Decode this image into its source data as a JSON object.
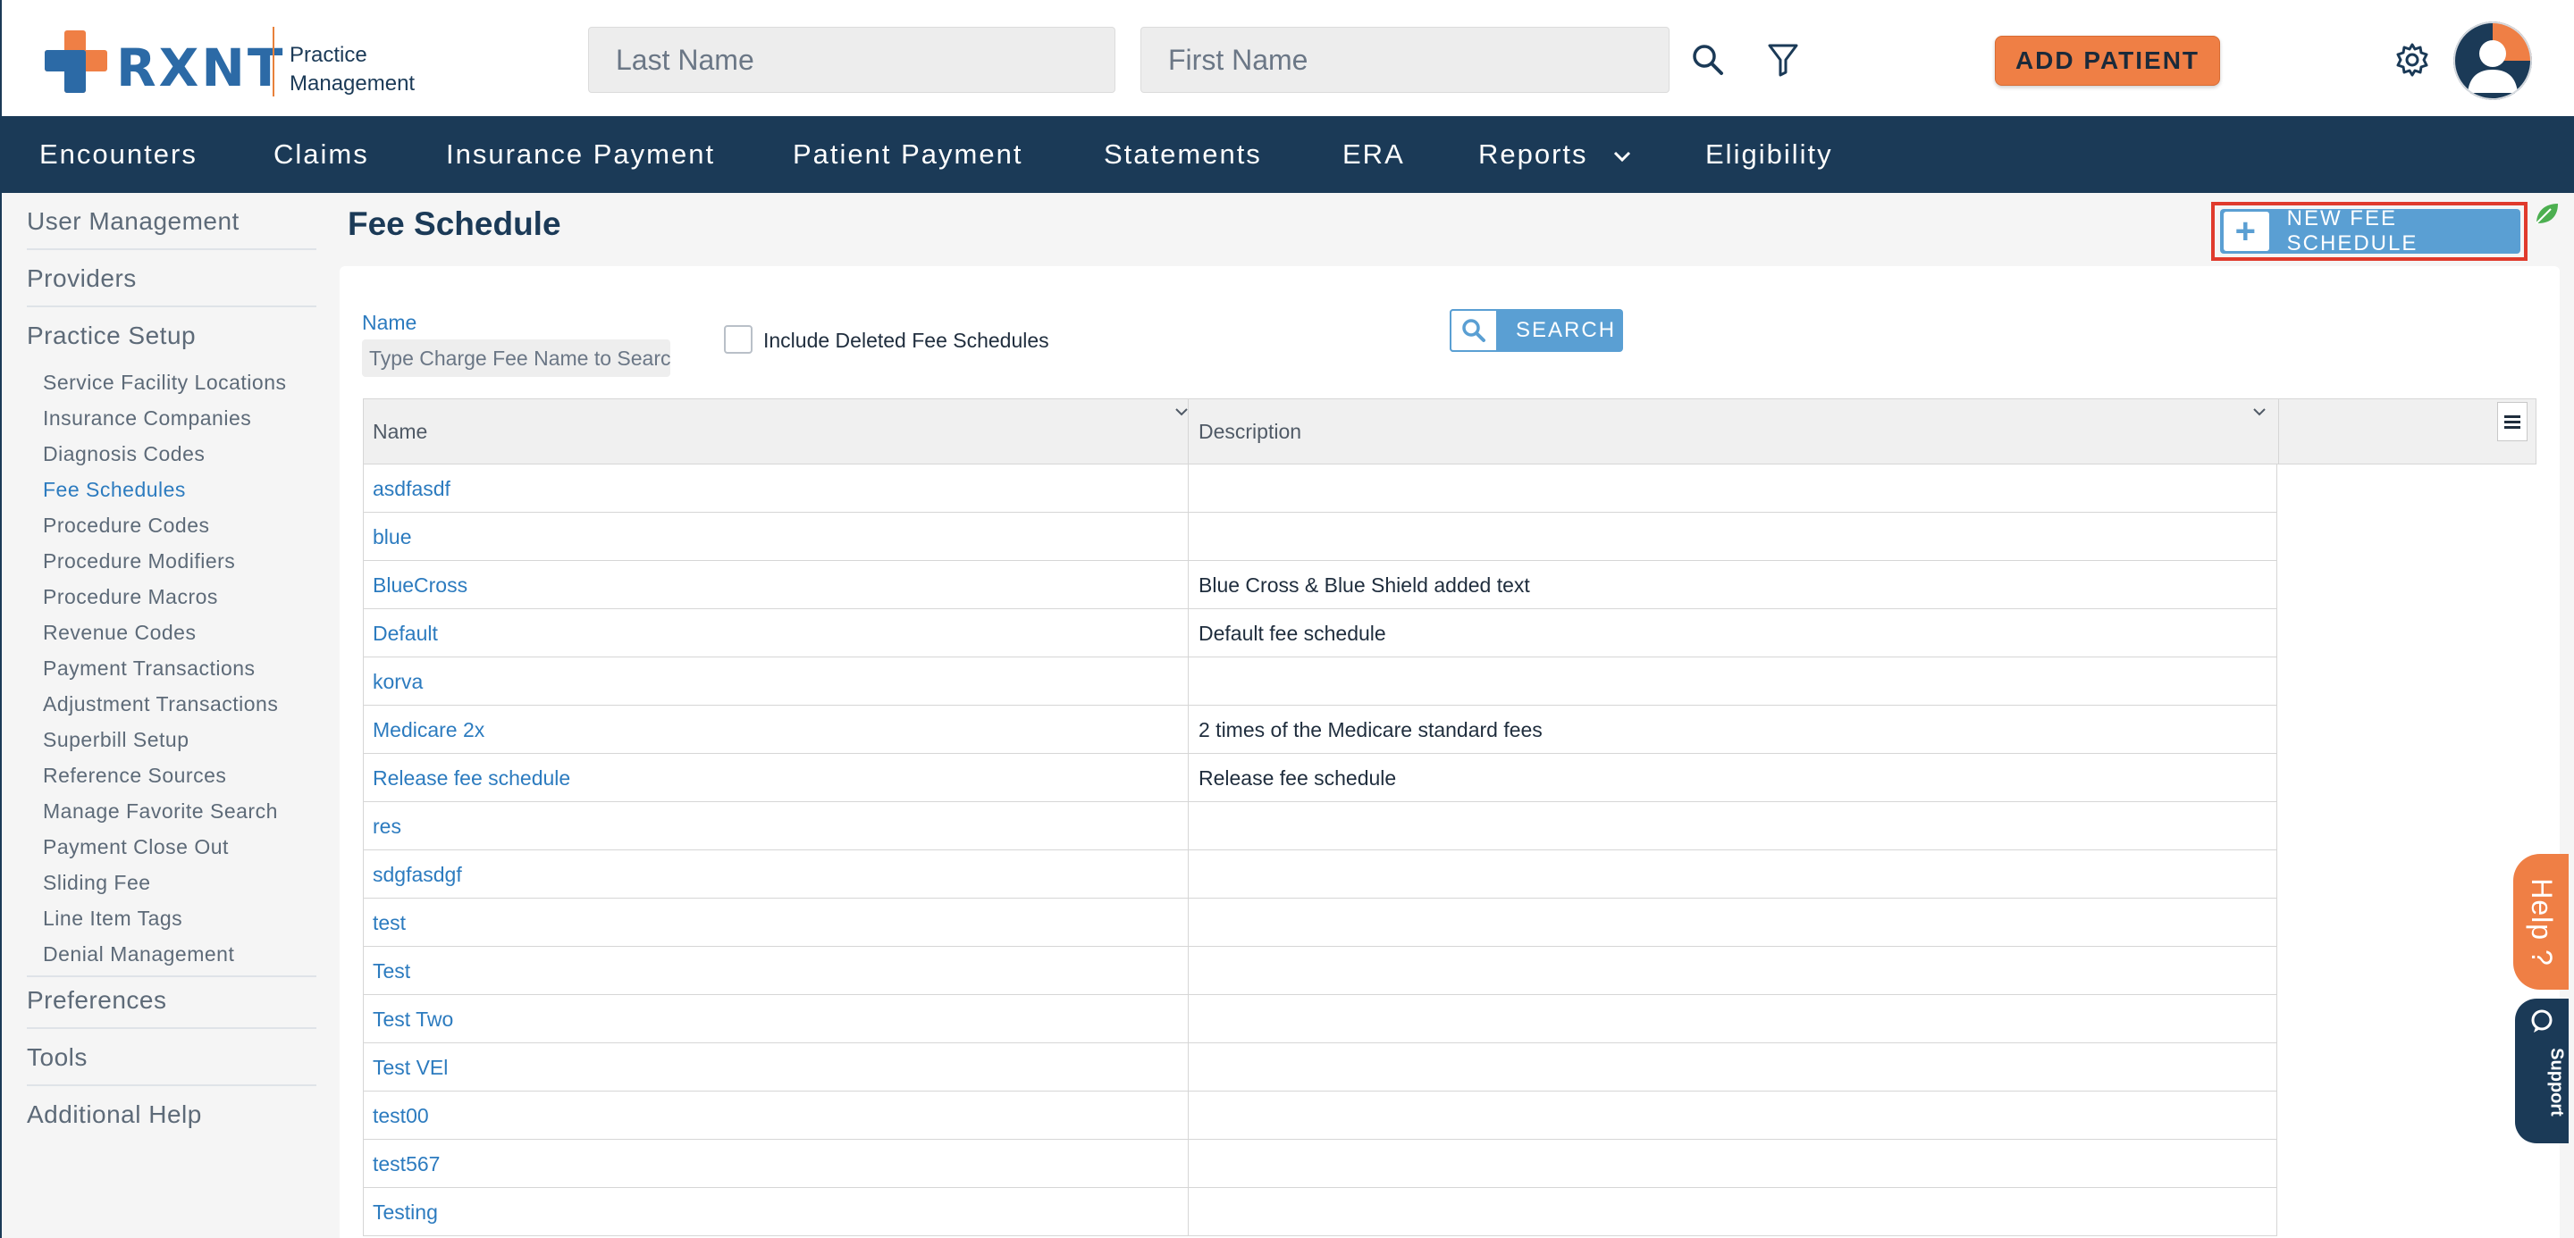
{
  "brand": {
    "name": "RXNT",
    "product_line1": "Practice",
    "product_line2": "Management",
    "orange": "#ef7f45",
    "blue": "#2c6aa6",
    "navy": "#1b3a57"
  },
  "header": {
    "last_name_placeholder": "Last Name",
    "first_name_placeholder": "First Name",
    "search_icon": "magnifier-icon",
    "filter_icon": "filter-icon",
    "add_patient_label": "ADD PATIENT",
    "settings_icon": "gear-icon",
    "avatar_icon": "user-avatar-icon"
  },
  "nav": {
    "items": [
      {
        "label": "Encounters"
      },
      {
        "label": "Claims"
      },
      {
        "label": "Insurance Payment"
      },
      {
        "label": "Patient Payment"
      },
      {
        "label": "Statements"
      },
      {
        "label": "ERA"
      },
      {
        "label": "Reports"
      },
      {
        "label": "Eligibility"
      }
    ]
  },
  "sidebar": {
    "top_sections": [
      "User Management",
      "Providers",
      "Practice Setup"
    ],
    "practice_setup_items": [
      "Service Facility Locations",
      "Insurance Companies",
      "Diagnosis Codes",
      "Fee Schedules",
      "Procedure Codes",
      "Procedure Modifiers",
      "Procedure Macros",
      "Revenue Codes",
      "Payment Transactions",
      "Adjustment Transactions",
      "Superbill Setup",
      "Reference Sources",
      "Manage Favorite Search",
      "Payment Close Out",
      "Sliding Fee",
      "Line Item Tags",
      "Denial Management"
    ],
    "active_item": "Fee Schedules",
    "bottom_sections": [
      "Preferences",
      "Tools",
      "Additional Help"
    ]
  },
  "page": {
    "title": "Fee Schedule",
    "new_button_label": "NEW FEE SCHEDULE"
  },
  "filters": {
    "name_label": "Name",
    "name_placeholder": "Type Charge Fee Name to Search",
    "include_deleted_label": "Include Deleted Fee Schedules",
    "include_deleted_checked": false,
    "search_label": "SEARCH"
  },
  "grid": {
    "columns": [
      "Name",
      "Description"
    ],
    "rows": [
      {
        "name": "asdfasdf",
        "description": ""
      },
      {
        "name": "blue",
        "description": ""
      },
      {
        "name": "BlueCross",
        "description": "Blue Cross & Blue Shield added text"
      },
      {
        "name": "Default",
        "description": "Default fee schedule"
      },
      {
        "name": "korva",
        "description": ""
      },
      {
        "name": "Medicare 2x",
        "description": "2 times of the Medicare standard fees"
      },
      {
        "name": "Release fee schedule",
        "description": "Release fee schedule"
      },
      {
        "name": "res",
        "description": ""
      },
      {
        "name": "sdgfasdgf",
        "description": ""
      },
      {
        "name": "test",
        "description": ""
      },
      {
        "name": "Test",
        "description": ""
      },
      {
        "name": "Test Two",
        "description": ""
      },
      {
        "name": "Test VEl",
        "description": ""
      },
      {
        "name": "test00",
        "description": ""
      },
      {
        "name": "test567",
        "description": ""
      },
      {
        "name": "Testing",
        "description": ""
      }
    ]
  },
  "floating": {
    "help_label": "Help ?",
    "support_label": "Support"
  }
}
